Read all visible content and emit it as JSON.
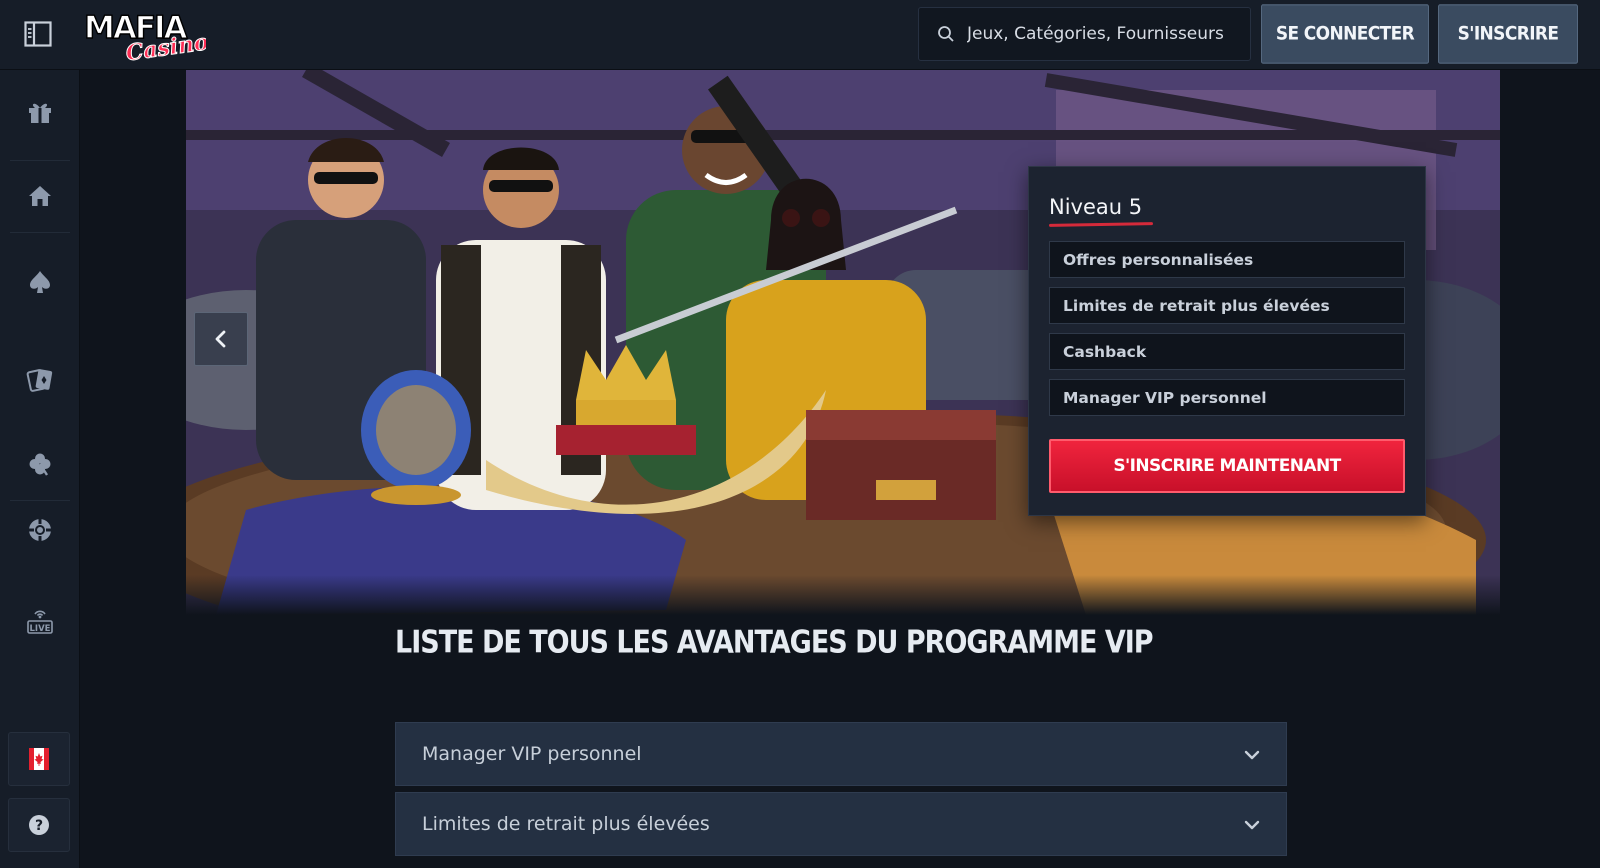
{
  "brand": {
    "name_top": "MAFIA",
    "name_script": "Casino"
  },
  "search": {
    "placeholder": "Jeux, Catégories, Fournisseurs"
  },
  "header": {
    "login_label": "SE CONNECTER",
    "register_label": "S'INSCRIRE"
  },
  "sidebar": {
    "items": [
      {
        "icon": "gift-icon"
      },
      {
        "icon": "home-icon"
      },
      {
        "icon": "spade-icon"
      },
      {
        "icon": "cards-icon"
      },
      {
        "icon": "clover-icon"
      },
      {
        "icon": "chip-icon"
      },
      {
        "icon": "live-icon",
        "label": "LIVE"
      }
    ],
    "language_flag": "canada-flag-icon",
    "help_label": "?"
  },
  "banner": {
    "vip_card": {
      "level": "Niveau 5",
      "perks": [
        "Offres personnalisées",
        "Limites de retrait plus élevées",
        "Cashback",
        "Manager VIP personnel"
      ],
      "cta_label": "S'INSCRIRE MAINTENANT"
    }
  },
  "benefits": {
    "title": "LISTE DE TOUS LES AVANTAGES DU PROGRAMME VIP",
    "items": [
      {
        "label": "Manager VIP personnel"
      },
      {
        "label": "Limites de retrait plus élevées"
      }
    ]
  },
  "colors": {
    "background": "#0f141c",
    "panel": "#161d28",
    "accent_red": "#e11d36",
    "button_slate": "#3a4b60"
  }
}
